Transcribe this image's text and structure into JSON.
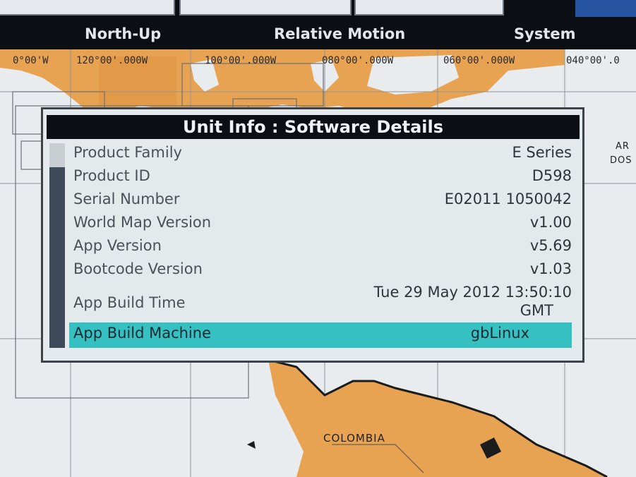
{
  "menu": {
    "items": [
      {
        "label": "North-Up"
      },
      {
        "label": "Relative Motion"
      },
      {
        "label": "System"
      }
    ]
  },
  "map": {
    "longitude_labels": [
      "0°00'W",
      "120°00'.000W",
      "100°00'.000W",
      "080°00'.000W",
      "060°00'.000W",
      "040°00'.0"
    ],
    "places": {
      "colombia": "COLOMBIA",
      "partial_1": "AR",
      "partial_2": "DOS"
    },
    "colors": {
      "land": "#e8a352",
      "water": "#e8ecee",
      "dark_land": "#d88c38"
    }
  },
  "dialog": {
    "title": "Unit Info : Software Details",
    "rows": [
      {
        "label": "Product Family",
        "value": "E Series"
      },
      {
        "label": "Product ID",
        "value": "D598"
      },
      {
        "label": "Serial Number",
        "value": "E02011 1050042"
      },
      {
        "label": "World Map Version",
        "value": "v1.00"
      },
      {
        "label": "App Version",
        "value": "v5.69"
      },
      {
        "label": "Bootcode Version",
        "value": "v1.03"
      },
      {
        "label": "App Build Time",
        "value_line1": "Tue 29 May 2012 13:50:10",
        "value_line2": "GMT"
      },
      {
        "label": "App Build Machine",
        "value": "gbLinux"
      }
    ],
    "selected_color": "#35c0c2"
  }
}
